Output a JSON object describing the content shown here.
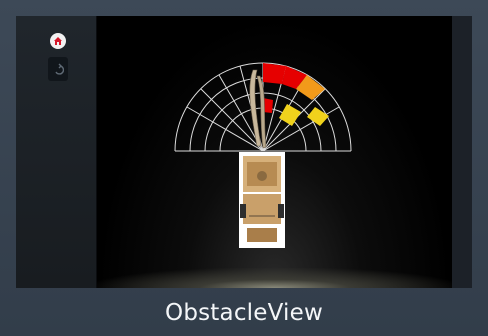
{
  "app": {
    "title": "ObstacleView"
  },
  "sidebar": {
    "home_icon": "home-icon",
    "back_icon": "back-arrow-icon"
  },
  "obstacle_view": {
    "sensor_zones": {
      "near_right": "#e60000",
      "mid_right": "#f29a1a",
      "far_right": "#f0d21c"
    },
    "grid_color": "#dcdcdc",
    "vehicle": "top-down-vehicle-illustration"
  }
}
